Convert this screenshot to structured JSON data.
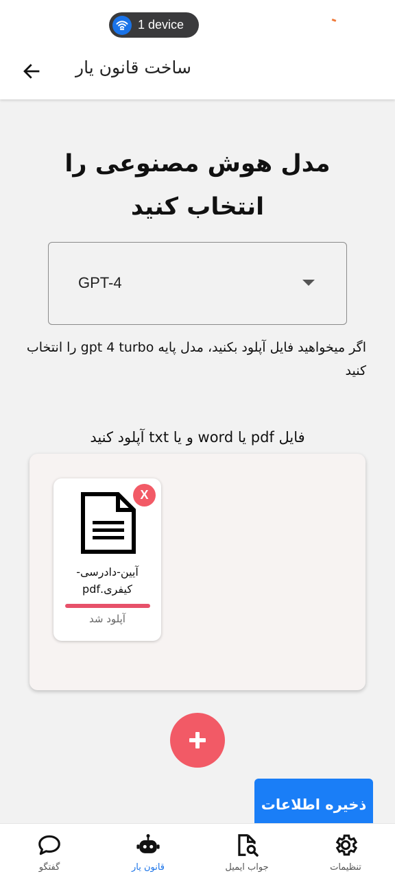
{
  "status_bar": {
    "device_label": "1 device",
    "device_icon": "wifi-icon"
  },
  "app_bar": {
    "title": "ساخت قانون یار",
    "back_icon": "arrow-back-icon"
  },
  "main": {
    "heading": "مدل هوش مصنوعی را انتخاب کنید",
    "model_select": {
      "selected": "GPT-4"
    },
    "hint": "اگر میخواهید فایل آپلود بکنید، مدل پایه gpt 4 turbo را انتخاب کنید",
    "upload_hint": "فایل pdf یا word و یا txt آپلود کنید",
    "files": [
      {
        "name": "آیین-دادرسی-کیفری.pdf",
        "status": "آپلود شد",
        "progress": 1.0,
        "remove_label": "X"
      }
    ],
    "add_icon": "plus-icon",
    "save_label": "ذخیره اطلاعات"
  },
  "bottom_nav": {
    "items": [
      {
        "label": "تنظیمات",
        "icon": "gear-icon",
        "active": false
      },
      {
        "label": "جواب ایمیل",
        "icon": "document-search-icon",
        "active": false
      },
      {
        "label": "قانون یار",
        "icon": "robot-icon",
        "active": true
      },
      {
        "label": "گفتگو",
        "icon": "chat-bubble-icon",
        "active": false
      }
    ]
  },
  "colors": {
    "accent": "#1a73e8",
    "danger": "#f25a66",
    "save_button": "#1a7ef7",
    "background": "#f2f2f2"
  }
}
